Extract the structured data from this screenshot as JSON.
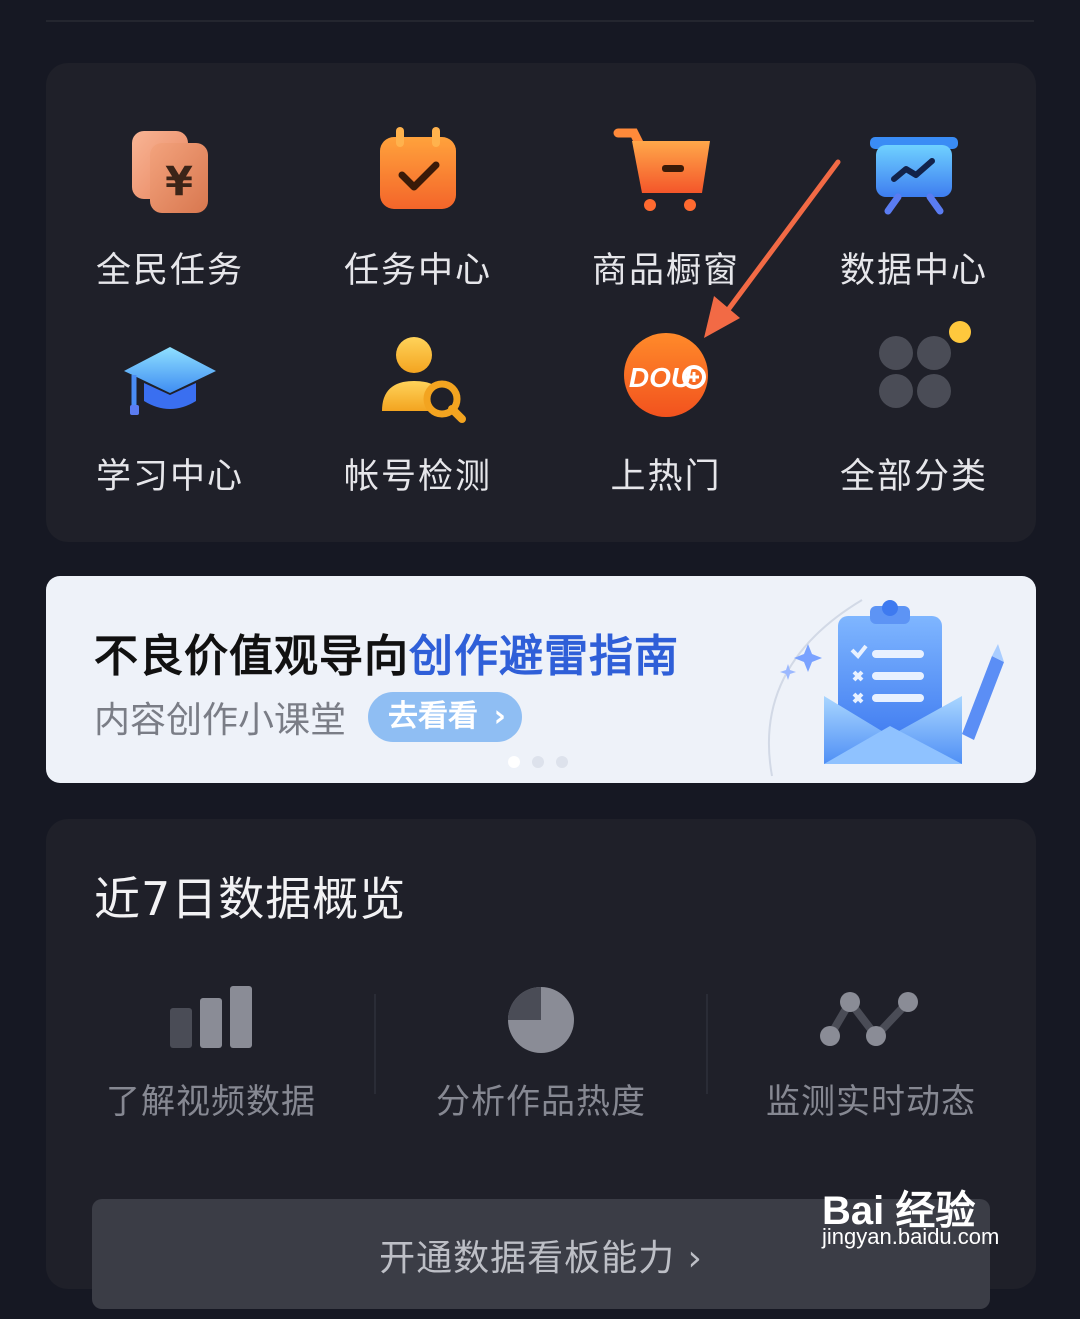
{
  "tools": [
    {
      "label": "全民任务",
      "icon": "yuan-cards-icon"
    },
    {
      "label": "任务中心",
      "icon": "calendar-check-icon"
    },
    {
      "label": "商品橱窗",
      "icon": "shopping-cart-icon"
    },
    {
      "label": "数据中心",
      "icon": "chart-board-icon"
    },
    {
      "label": "学习中心",
      "icon": "graduation-cap-icon"
    },
    {
      "label": "帐号检测",
      "icon": "user-search-icon"
    },
    {
      "label": "上热门",
      "icon": "dou-plus-icon",
      "logo_text": "DOU"
    },
    {
      "label": "全部分类",
      "icon": "grid-categories-icon"
    }
  ],
  "banner": {
    "title_part1": "不良价值观导向",
    "title_part2": "创作避雷指南",
    "subtitle": "内容创作小课堂",
    "button_label": "去看看",
    "button_chevron": "›",
    "accent_color": "#2f5fd8"
  },
  "overview": {
    "title": "近7日数据概览",
    "features": [
      {
        "label": "了解视频数据",
        "icon": "bar-chart-icon"
      },
      {
        "label": "分析作品热度",
        "icon": "pie-chart-icon"
      },
      {
        "label": "监测实时动态",
        "icon": "line-trend-icon"
      }
    ],
    "open_button": "开通数据看板能力 ›"
  },
  "watermark": {
    "logo": "Bai 经验",
    "site": "jingyan.baidu.com"
  }
}
